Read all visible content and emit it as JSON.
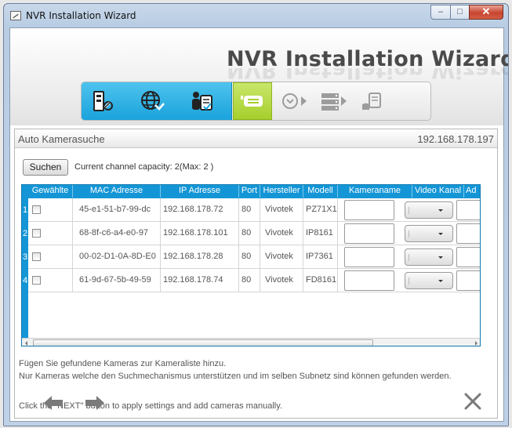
{
  "window": {
    "title": "NVR Installation Wizard",
    "controls": {
      "minimize": "–",
      "maximize": "□",
      "close": "✕"
    }
  },
  "header": {
    "title": "NVR Installation Wizard",
    "steps": [
      {
        "icon": "device-gear-icon",
        "state": "done"
      },
      {
        "icon": "globe-network-icon",
        "state": "done"
      },
      {
        "icon": "user-document-icon",
        "state": "done"
      },
      {
        "icon": "camera-search-icon",
        "state": "current"
      },
      {
        "icon": "clock-schedule-icon",
        "state": "pending"
      },
      {
        "icon": "storage-list-icon",
        "state": "pending"
      },
      {
        "icon": "finish-hand-icon",
        "state": "pending"
      }
    ],
    "colors": {
      "done": "#1aa3dc",
      "current": "#a6cf2c",
      "pending": "#9c9c9c"
    }
  },
  "panel": {
    "title": "Auto Kamerasuche",
    "ip": "192.168.178.197",
    "search_button": "Suchen",
    "capacity": "Current channel capacity: 2(Max: 2 )"
  },
  "table": {
    "columns": [
      "Gewählte",
      "MAC Adresse",
      "IP Adresse",
      "Port",
      "Hersteller",
      "Modell",
      "Kameraname",
      "Video Kanal",
      "Ad"
    ],
    "rows": [
      {
        "num": "1",
        "mac": "45-e1-51-b7-99-dc",
        "ip": "192.168.178.72",
        "port": "80",
        "vendor": "Vivotek",
        "model": "PZ71X1",
        "name": "",
        "channel": ""
      },
      {
        "num": "2",
        "mac": "68-8f-c6-a4-e0-97",
        "ip": "192.168.178.101",
        "port": "80",
        "vendor": "Vivotek",
        "model": "IP8161",
        "name": "",
        "channel": ""
      },
      {
        "num": "3",
        "mac": "00-02-D1-0A-8D-E0",
        "ip": "192.168.178.28",
        "port": "80",
        "vendor": "Vivotek",
        "model": "IP7361",
        "name": "",
        "channel": ""
      },
      {
        "num": "4",
        "mac": "61-9d-67-5b-49-59",
        "ip": "192.168.178.74",
        "port": "80",
        "vendor": "Vivotek",
        "model": "FD8161",
        "name": "",
        "channel": ""
      }
    ]
  },
  "info": {
    "line1": "Fügen Sie gefundene Kameras zur Kameraliste hinzu.",
    "line2": "Nur Kameras welche den Suchmechanismus unterstützen und im selben Subnetz sind können gefunden werden.",
    "line3": "Click the \"NEXT\" button to apply settings and add cameras manually."
  },
  "footer": {
    "back_icon": "arrow-left-icon",
    "next_icon": "arrow-right-icon",
    "close_icon": "close-icon"
  }
}
